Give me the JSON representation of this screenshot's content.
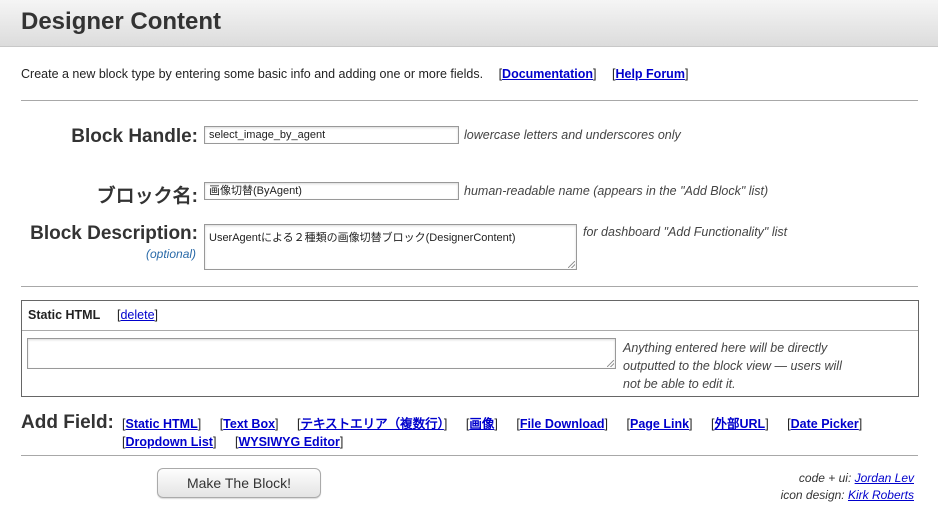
{
  "header": {
    "title": "Designer Content"
  },
  "intro": {
    "text": "Create a new block type by entering some basic info and adding one or more fields.",
    "documentation_link": "Documentation",
    "help_forum_link": "Help Forum"
  },
  "form": {
    "handle": {
      "label": "Block Handle:",
      "value": "select_image_by_agent",
      "hint": "lowercase letters and underscores only"
    },
    "name": {
      "label": "ブロック名:",
      "value": "画像切替(ByAgent)",
      "hint": "human-readable name (appears in the \"Add Block\" list)"
    },
    "description": {
      "label": "Block Description:",
      "optional": "(optional)",
      "value": "UserAgentによる２種類の画像切替ブロック(DesignerContent)",
      "hint": "for dashboard \"Add Functionality\" list"
    }
  },
  "field": {
    "title": "Static HTML",
    "delete_link": "delete",
    "value": "",
    "hint_lines": [
      "Anything entered here will be directly",
      "outputted to the block view — users will",
      "not be able to edit it."
    ]
  },
  "add_field": {
    "label": "Add Field:",
    "items": [
      "Static HTML",
      "Text Box",
      "テキストエリア（複数行）",
      "画像",
      "File Download",
      "Page Link",
      "外部URL",
      "Date Picker",
      "Dropdown List",
      "WYSIWYG Editor"
    ]
  },
  "submit": {
    "label": "Make The Block!"
  },
  "credits": {
    "code_label": "code + ui:",
    "code_name": "Jordan Lev",
    "icon_label": "icon design:",
    "icon_name": "Kirk Roberts"
  }
}
